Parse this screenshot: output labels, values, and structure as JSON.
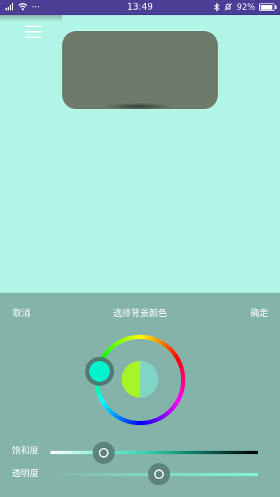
{
  "status_bar": {
    "time": "13:49",
    "left_dots": "···",
    "battery_percent_text": "92%",
    "battery_level": 0.92,
    "icons": [
      "sim-signal-icon",
      "wifi-icon",
      "bluetooth-icon",
      "mute-icon",
      "battery-icon"
    ]
  },
  "preview": {
    "card_color": "#6e7b6a",
    "background_color": "#b1f5e6"
  },
  "picker": {
    "cancel_label": "取消",
    "title": "选择背景颜色",
    "confirm_label": "确定",
    "panel_color": "#84b3a9",
    "selected_color": "#00f5d0",
    "compare_old_color": "#a6f52a",
    "compare_new_color": "#7fd6c6",
    "saturation_label": "饱和度",
    "opacity_label": "透明度",
    "saturation_value": 0.26,
    "opacity_value": 0.52
  }
}
